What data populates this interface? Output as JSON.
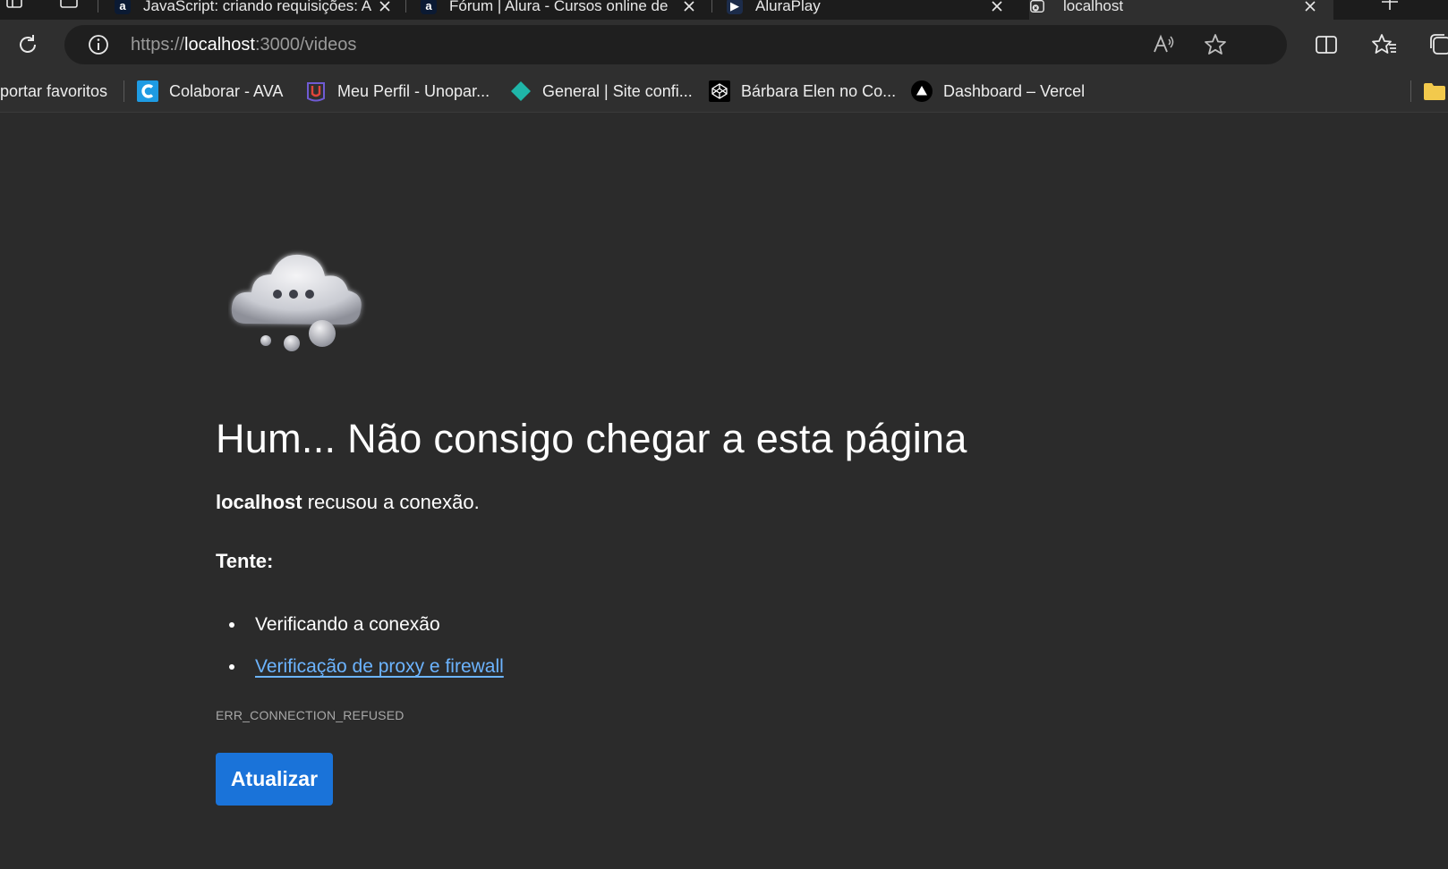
{
  "tabs": [
    {
      "title": "JavaScript: criando requisições: A",
      "active": false,
      "favicon": "alura-icon"
    },
    {
      "title": "Fórum | Alura - Cursos online de",
      "active": false,
      "favicon": "alura-icon"
    },
    {
      "title": "AluraPlay",
      "active": false,
      "favicon": "aluraplay-icon"
    },
    {
      "title": "localhost",
      "active": true,
      "favicon": "error-page-icon"
    }
  ],
  "address_bar": {
    "scheme": "https://",
    "host": "localhost",
    "rest": ":3000/videos"
  },
  "bookmarks": [
    {
      "label": "portar favoritos",
      "icon": "import-icon"
    },
    {
      "label": "Colaborar - AVA",
      "icon": "colaborar-icon"
    },
    {
      "label": "Meu Perfil - Unopar...",
      "icon": "unopar-icon"
    },
    {
      "label": "General | Site confi...",
      "icon": "diamond-icon"
    },
    {
      "label": "Bárbara Elen no Co...",
      "icon": "codepen-icon"
    },
    {
      "label": "Dashboard – Vercel",
      "icon": "vercel-icon"
    }
  ],
  "error_page": {
    "headline": "Hum... Não consigo chegar a esta página",
    "host_bold": "localhost",
    "message_rest": " recusou a conexão.",
    "try_label": "Tente:",
    "suggestions": [
      {
        "text": "Verificando a conexão",
        "link": false
      },
      {
        "text": "Verificação de proxy e firewall",
        "link": true
      }
    ],
    "error_code": "ERR_CONNECTION_REFUSED",
    "reload_button": "Atualizar"
  },
  "colors": {
    "page_bg": "#2b2b2b",
    "toolbar_bg": "#2f2f2f",
    "link": "#6cb4ff",
    "button": "#1a73d9"
  }
}
